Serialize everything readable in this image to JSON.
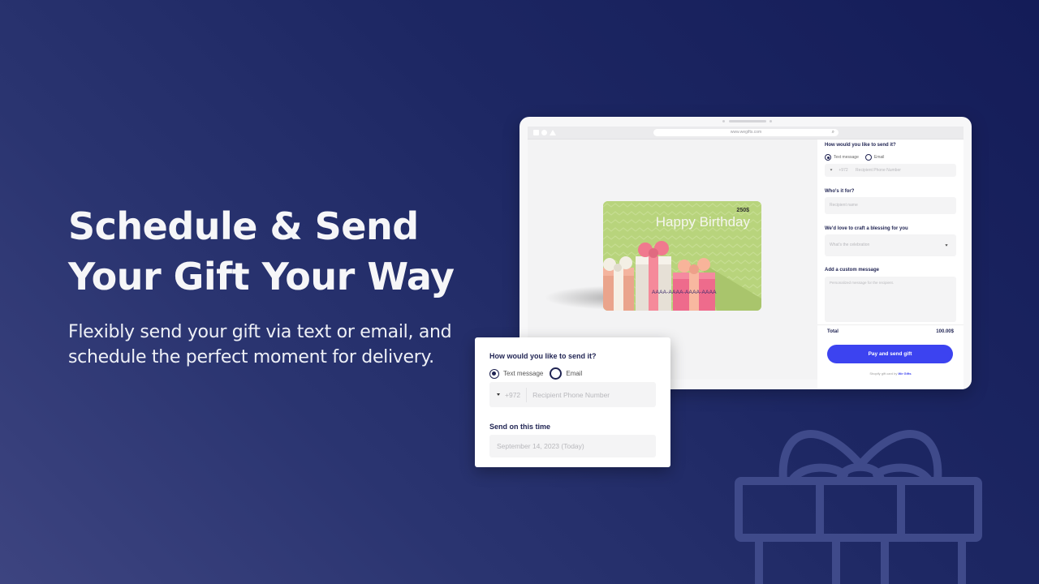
{
  "hero": {
    "title_line1": "Schedule & Send",
    "title_line2": "Your Gift Your Way",
    "subtitle": "Flexibly send your gift via text or email, and schedule the perfect moment for delivery."
  },
  "browser": {
    "url": "www.wegifts.com",
    "gift_card": {
      "amount": "250$",
      "title": "Happy Birthday",
      "code": "AAAA-AAAA-AAAA-AAAA"
    },
    "form": {
      "send_question": "How would you like to send it?",
      "option_text": "Text message",
      "option_email": "Email",
      "country_code": "+972",
      "phone_placeholder": "Recipient Phone Number",
      "recipient_label": "Who's it for?",
      "recipient_placeholder": "Recipient name",
      "blessing_label": "We'd love to craft a blessing for you",
      "blessing_placeholder": "What's the celebration",
      "message_label": "Add a custom message",
      "message_placeholder": "Personalized message for the recipient.",
      "total_label": "Total",
      "total_value": "100.00$",
      "pay_button": "Pay and send gift",
      "credit_prefix": "Shopify gift card by",
      "credit_brand": "We Gifts"
    }
  },
  "popup": {
    "send_question": "How would you like to send it?",
    "option_text": "Text message",
    "option_email": "Email",
    "selected_option": "Text message",
    "country_code": "+972",
    "phone_placeholder": "Recipient Phone Number",
    "schedule_label": "Send on this time",
    "schedule_value": "September 14, 2023 (Today)"
  },
  "colors": {
    "accent": "#3c43f0",
    "navy_text": "#1f2352",
    "bg_dark": "#141c58",
    "bg_light": "#3d4480",
    "card_green": "#b8d47c"
  }
}
